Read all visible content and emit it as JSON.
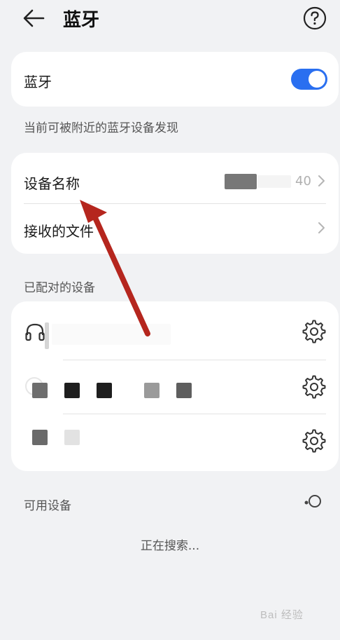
{
  "header": {
    "title": "蓝牙",
    "back_icon": "arrow-left-icon",
    "help_icon": "question-circle-icon"
  },
  "bluetooth": {
    "label": "蓝牙",
    "enabled": true,
    "accent_color": "#2a6ff0",
    "discoverable_note": "当前可被附近的蓝牙设备发现"
  },
  "device_settings": {
    "device_name_label": "设备名称",
    "device_name_value_suffix": "40",
    "received_files_label": "接收的文件"
  },
  "paired": {
    "section_title": "已配对的设备",
    "devices": [
      {
        "icon": "headset-icon",
        "settings_icon": "gear-icon"
      },
      {
        "icon": "device-icon",
        "settings_icon": "gear-icon"
      },
      {
        "icon": "device-icon",
        "settings_icon": "gear-icon"
      }
    ]
  },
  "available": {
    "section_title": "可用设备",
    "status": "正在搜索...",
    "refresh_icon": "spinner-icon"
  },
  "watermark": "Bai 经验"
}
